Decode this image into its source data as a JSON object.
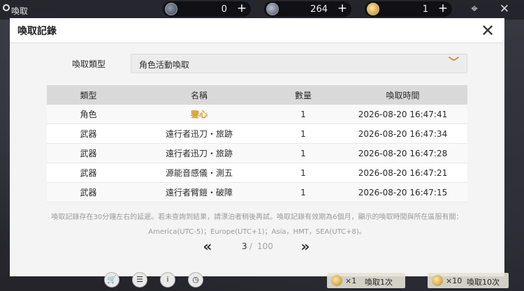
{
  "topbar": {
    "title": "喚取",
    "resources": [
      {
        "icon": "lunite-icon",
        "value": "0"
      },
      {
        "icon": "star-icon",
        "value": "264"
      },
      {
        "icon": "gold-coin-icon",
        "value": "1"
      }
    ]
  },
  "modal": {
    "title": "喚取記錄",
    "filter_label": "喚取類型",
    "filter_value": "角色活動喚取",
    "columns": [
      "類型",
      "名稱",
      "數量",
      "喚取時間"
    ],
    "rows": [
      {
        "type": "角色",
        "name": "鑒心",
        "qty": "1",
        "time": "2026-08-20 16:47:41",
        "highlight": true
      },
      {
        "type": "武器",
        "name": "遠行者迅刀・旅跡",
        "qty": "1",
        "time": "2026-08-20 16:47:34",
        "highlight": false
      },
      {
        "type": "武器",
        "name": "遠行者迅刀・旅跡",
        "qty": "1",
        "time": "2026-08-20 16:47:28",
        "highlight": false
      },
      {
        "type": "武器",
        "name": "源能音感儀・測五",
        "qty": "1",
        "time": "2026-08-20 16:47:21",
        "highlight": false
      },
      {
        "type": "武器",
        "name": "遠行者臂鎧・破障",
        "qty": "1",
        "time": "2026-08-20 16:47:15",
        "highlight": false
      }
    ],
    "notice_line1": "喚取記錄存在30分鐘左右的延遲。若未查詢到結果，請漂泊者稍後再試。喚取記錄有效期為6個月，顯示的喚取時間與所在區服有關：",
    "notice_line2": "America(UTC-5)；Europe(UTC+1)；Asia，HMT，SEA(UTC+8)。",
    "pager": {
      "current": "3",
      "separator": "/",
      "total": "100"
    }
  },
  "bottombar": {
    "pull_one": {
      "count": "×1",
      "label": "喚取1次"
    },
    "pull_ten": {
      "count": "×10",
      "label": "喚取10次"
    }
  },
  "colors": {
    "accent_gold": "#d3a022",
    "chevron": "#b8892d"
  }
}
